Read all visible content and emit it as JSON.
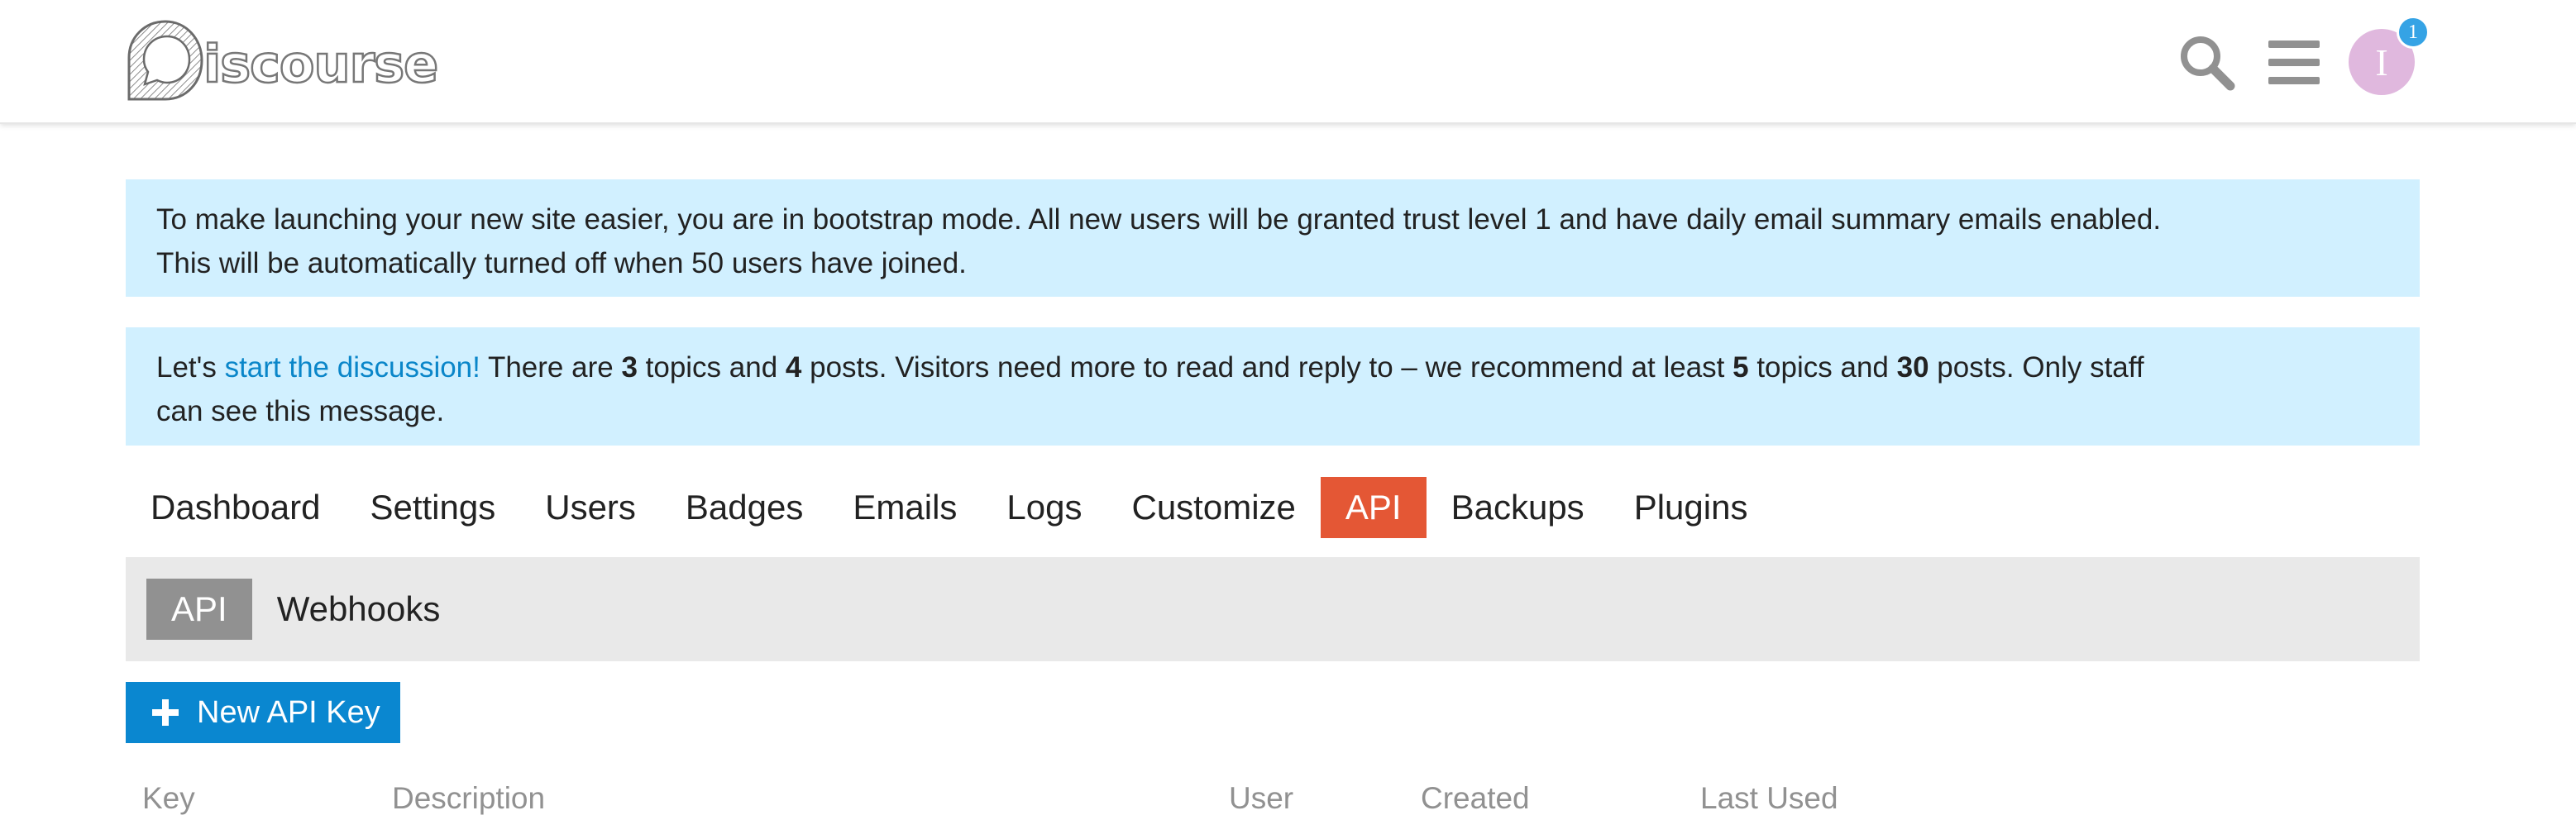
{
  "header": {
    "logo_text": "iscourse",
    "icons": {
      "search": "search-icon",
      "menu": "hamburger-menu-icon",
      "avatar_letter": "I",
      "notification_count": "1"
    }
  },
  "notices": {
    "bootstrap": {
      "line1": "To make launching your new site easier, you are in bootstrap mode. All new users will be granted trust level 1 and have daily email summary emails enabled.",
      "line2": "This will be automatically turned off when 50 users have joined."
    },
    "discussion": {
      "prefix": "Let's ",
      "link": "start the discussion!",
      "t1": " There are ",
      "topics": "3",
      "t2": " topics and ",
      "posts": "4",
      "t3": " posts. Visitors need more to read and reply to – we recommend at least ",
      "rec_topics": "5",
      "t4": " topics and ",
      "rec_posts": "30",
      "t5": " posts. Only staff",
      "line2": "can see this message."
    }
  },
  "nav": {
    "items": [
      {
        "label": "Dashboard"
      },
      {
        "label": "Settings"
      },
      {
        "label": "Users"
      },
      {
        "label": "Badges"
      },
      {
        "label": "Emails"
      },
      {
        "label": "Logs"
      },
      {
        "label": "Customize"
      },
      {
        "label": "API"
      },
      {
        "label": "Backups"
      },
      {
        "label": "Plugins"
      }
    ],
    "active": "API"
  },
  "subnav": {
    "items": [
      {
        "label": "API"
      },
      {
        "label": "Webhooks"
      }
    ],
    "active": "API"
  },
  "actions": {
    "new_api_key": "New API Key"
  },
  "table": {
    "columns": [
      "Key",
      "Description",
      "User",
      "Created",
      "Last Used"
    ]
  },
  "colors": {
    "accent_active_tab": "#e45735",
    "primary_button": "#0a87d0",
    "notice_bg": "#d1f0ff",
    "link": "#0a86c9",
    "subnav_bg": "#e9e9e9",
    "subnav_active": "#919191",
    "avatar_bg": "#e0b8de",
    "badge": "#35a3e5"
  }
}
